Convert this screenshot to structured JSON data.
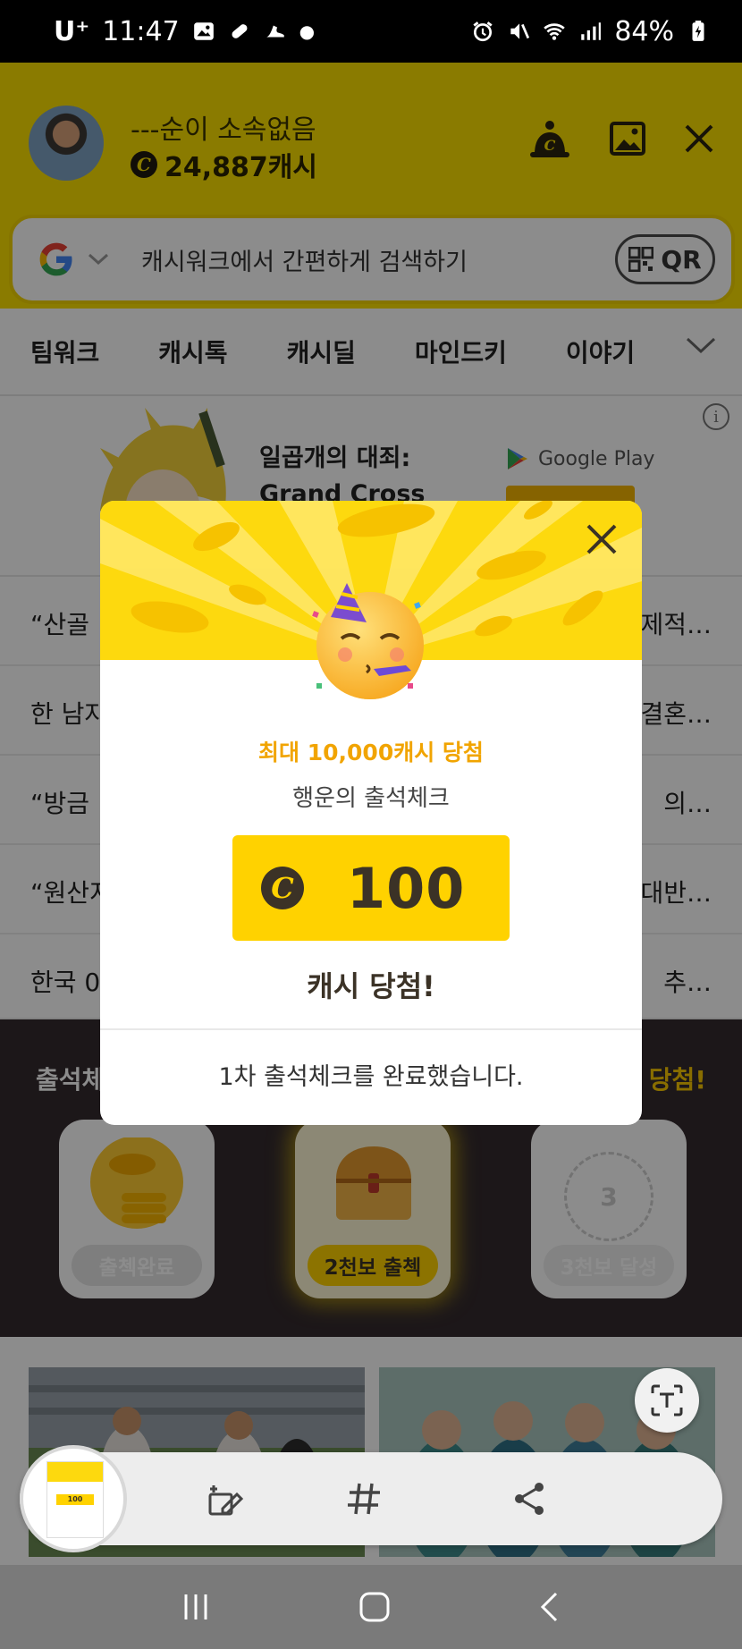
{
  "status_bar": {
    "carrier": "U⁺",
    "time": "11:47",
    "battery": "84%"
  },
  "header": {
    "username": "---순이 소속없음",
    "cash_amount": "24,887캐시",
    "coin_symbol": "C",
    "icons": [
      "cash-bell-icon",
      "image-icon",
      "close-icon"
    ]
  },
  "search": {
    "engine_icon": "google-icon",
    "placeholder": "캐시워크에서 간편하게 검색하기",
    "qr_label": "QR"
  },
  "tabs": [
    "팀워크",
    "캐시톡",
    "캐시딜",
    "마인드키",
    "이야기"
  ],
  "ad": {
    "title_line1": "일곱개의 대죄:",
    "title_line2": "Grand Cross",
    "store_label": "Google Play",
    "info_label": "i"
  },
  "news": [
    {
      "left": "“산골",
      "right": "제적…"
    },
    {
      "left": "한 남자",
      "right": "결혼…"
    },
    {
      "left": "“방금 ",
      "right": "의…"
    },
    {
      "left": "“원산지",
      "right": "대반…"
    },
    {
      "left": "한국 0",
      "right": "추…"
    }
  ],
  "attendance": {
    "title": "출석체",
    "win_text": "당첨!",
    "cards": [
      {
        "label": "출첵완료"
      },
      {
        "label": "2천보 출첵"
      },
      {
        "label": "3천보 달성",
        "step": "3"
      }
    ]
  },
  "modal": {
    "prize_line": "최대 10,000캐시 당첨",
    "subtitle": "행운의 출석체크",
    "coin_symbol": "C",
    "reward_amount": "100",
    "win_text": "캐시 당첨!",
    "footer": "1차 출석체크를 완료했습니다."
  },
  "screenshot_toolbar": {
    "tools": [
      "edit-icon",
      "hashtag-icon",
      "share-icon"
    ],
    "thumb_amount": "100"
  },
  "colors": {
    "brand_yellow": "#fbe000",
    "accent_orange": "#f1a400",
    "dark_brown": "#3b3226"
  }
}
